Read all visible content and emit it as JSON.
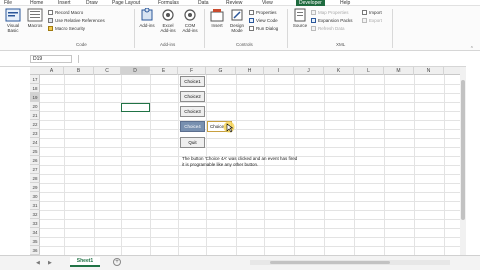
{
  "menubar": {
    "items": [
      "File",
      "Home",
      "Insert",
      "Draw",
      "Page Layout",
      "Formulas",
      "Data",
      "Review",
      "View",
      "Developer",
      "Help"
    ],
    "active": "Developer"
  },
  "ribbon": {
    "code": {
      "label": "Code",
      "visual_basic": "Visual Basic",
      "macros": "Macros",
      "record_macro": "Record Macro",
      "relative_refs": "Use Relative References",
      "macro_security": "Macro Security"
    },
    "addins": {
      "label": "Add-ins",
      "add_ins": "Add-ins",
      "excel_add_ins": "Excel Add-ins",
      "com_add_ins": "COM Add-ins"
    },
    "controls": {
      "label": "Controls",
      "insert": "Insert",
      "design_mode": "Design Mode",
      "properties": "Properties",
      "view_code": "View Code",
      "run_dialog": "Run Dialog"
    },
    "xml": {
      "label": "XML",
      "source": "Source",
      "map_properties": "Map Properties",
      "expansion_packs": "Expansion Packs",
      "refresh_data": "Refresh Data",
      "import": "Import",
      "export": "Export"
    },
    "colors": {
      "accent": "#217346",
      "active_tab": "#1f6b3f"
    }
  },
  "formula_bar": {
    "name_box": "D19"
  },
  "grid": {
    "columns": [
      "A",
      "B",
      "C",
      "D",
      "E",
      "F",
      "G",
      "H",
      "I",
      "J",
      "K",
      "L",
      "M",
      "N"
    ],
    "rows": [
      "17",
      "18",
      "19",
      "20",
      "21",
      "22",
      "23",
      "24",
      "25",
      "26",
      "27",
      "28",
      "29",
      "30",
      "31",
      "32",
      "33",
      "34",
      "35",
      "36"
    ]
  },
  "buttons": {
    "choice1": "Choice1",
    "choice2": "Choice2",
    "choice3": "Choice3",
    "choice4": "Choice4",
    "quit": "Quit"
  },
  "msgbox": {
    "text": "Choice 4"
  },
  "note": {
    "line1": "The button 'Choice 4A' was clicked and an event has fired",
    "line2": "it is programable like any other button."
  },
  "tabbar": {
    "sheet": "Sheet1"
  }
}
